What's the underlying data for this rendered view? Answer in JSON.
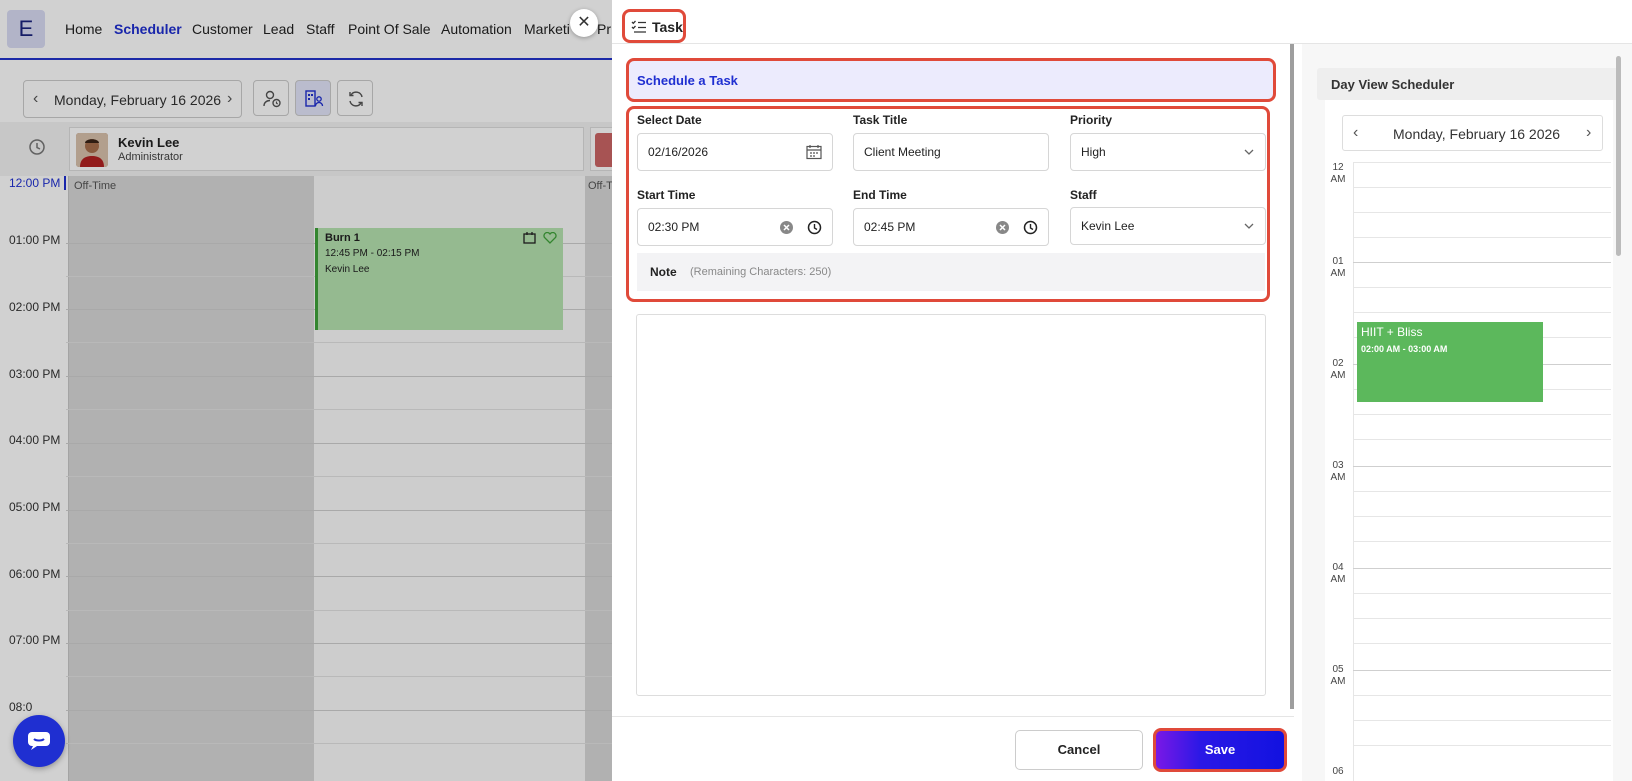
{
  "app": {
    "logo_letter": "E",
    "nav": [
      "Home",
      "Scheduler",
      "Customer",
      "Lead",
      "Staff",
      "Point Of Sale",
      "Automation",
      "Marketi",
      "Pr"
    ],
    "nav_active": "Scheduler",
    "toolbar": {
      "date_label": "Monday, February 16 2026"
    },
    "staff": {
      "name": "Kevin Lee",
      "role": "Administrator"
    },
    "times": [
      "12:00 PM",
      "01:00 PM",
      "02:00 PM",
      "03:00 PM",
      "04:00 PM",
      "05:00 PM",
      "06:00 PM",
      "07:00 PM",
      "08:0"
    ],
    "off_time_label": "Off-Time",
    "off_time_label_2": "Off-T",
    "appointment": {
      "title": "Burn 1",
      "time": "12:45 PM - 02:15 PM",
      "staff": "Kevin Lee"
    }
  },
  "panel": {
    "title": "Task",
    "section_header": "Schedule a Task",
    "fields": {
      "select_date": {
        "label": "Select Date",
        "value": "02/16/2026"
      },
      "task_title": {
        "label": "Task Title",
        "value": "Client Meeting"
      },
      "priority": {
        "label": "Priority",
        "value": "High"
      },
      "start_time": {
        "label": "Start Time",
        "value": "02:30 PM"
      },
      "end_time": {
        "label": "End Time",
        "value": "02:45 PM"
      },
      "staff": {
        "label": "Staff",
        "value": "Kevin Lee"
      }
    },
    "note": {
      "label": "Note",
      "remaining": "(Remaining Characters: 250)"
    },
    "buttons": {
      "cancel": "Cancel",
      "save": "Save"
    }
  },
  "day_view": {
    "title": "Day View Scheduler",
    "date_label": "Monday, February 16 2026",
    "hours": [
      {
        "h": "12",
        "m": "AM"
      },
      {
        "h": "01",
        "m": "AM"
      },
      {
        "h": "02",
        "m": "AM"
      },
      {
        "h": "03",
        "m": "AM"
      },
      {
        "h": "04",
        "m": "AM"
      },
      {
        "h": "05",
        "m": "AM"
      },
      {
        "h": "06",
        "m": ""
      }
    ],
    "event": {
      "title": "HIIT + Bliss",
      "time": "02:00 AM - 03:00 AM"
    }
  },
  "colors": {
    "accent": "#1f2fd1",
    "highlight_border": "#e04a3a",
    "event_green": "#5cb85c"
  }
}
